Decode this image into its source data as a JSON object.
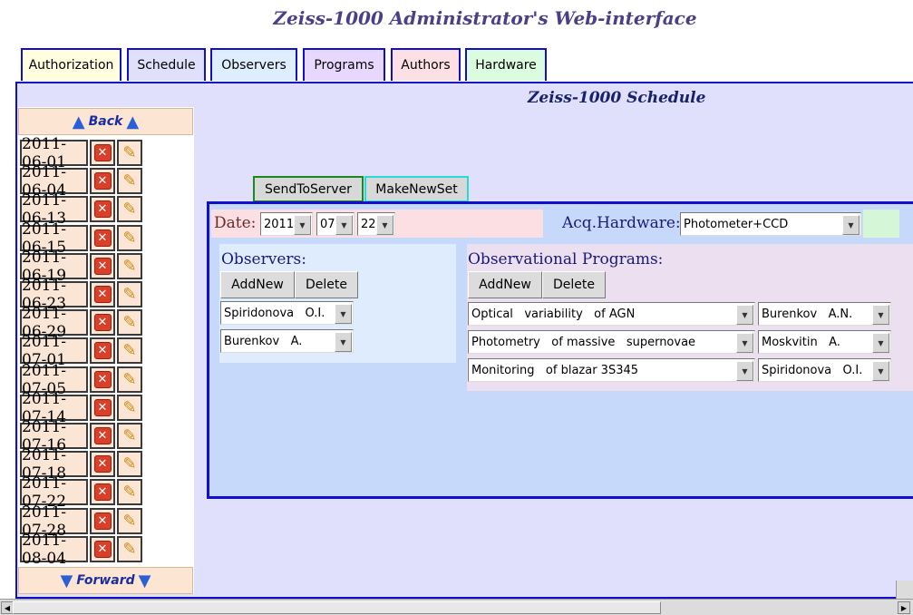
{
  "page_title": "Zeiss-1000 Administrator's Web-interface",
  "tabs": [
    {
      "label": "Authorization",
      "color": "#ffffdf"
    },
    {
      "label": "Schedule",
      "color": "#e0e0fc"
    },
    {
      "label": "Observers",
      "color": "#dfeeff"
    },
    {
      "label": "Programs",
      "color": "#e8d8ff"
    },
    {
      "label": "Authors",
      "color": "#fde0e6"
    },
    {
      "label": "Hardware",
      "color": "#dcfce0"
    }
  ],
  "schedule_title": "Zeiss-1000 Schedule",
  "nav": {
    "back": "Back",
    "forward": "Forward"
  },
  "dates": [
    "2011-06-01",
    "2011-06-04",
    "2011-06-13",
    "2011-06-15",
    "2011-06-19",
    "2011-06-23",
    "2011-06-29",
    "2011-07-01",
    "2011-07-05",
    "2011-07-14",
    "2011-07-16",
    "2011-07-18",
    "2011-07-22",
    "2011-07-28",
    "2011-08-04"
  ],
  "actions": {
    "send": "SendToServer",
    "new_set": "MakeNewSet"
  },
  "date_field": {
    "label": "Date:",
    "year": "2011",
    "month": "07",
    "day": "22"
  },
  "hardware": {
    "label": "Acq.Hardware:",
    "value": "Photometer+CCD"
  },
  "observers": {
    "title": "Observers:",
    "add": "AddNew",
    "delete": "Delete",
    "list": [
      "Spiridonova   O.I.",
      "Burenkov   A."
    ]
  },
  "programs": {
    "title": "Observational Programs:",
    "add": "AddNew",
    "delete": "Delete",
    "list": [
      {
        "program": "Optical   variability   of AGN",
        "author": "Burenkov   A.N."
      },
      {
        "program": "Photometry   of massive   supernovae",
        "author": "Moskvitin   A."
      },
      {
        "program": "Monitoring   of blazar 3S345",
        "author": "Spiridonova   O.I."
      }
    ]
  }
}
